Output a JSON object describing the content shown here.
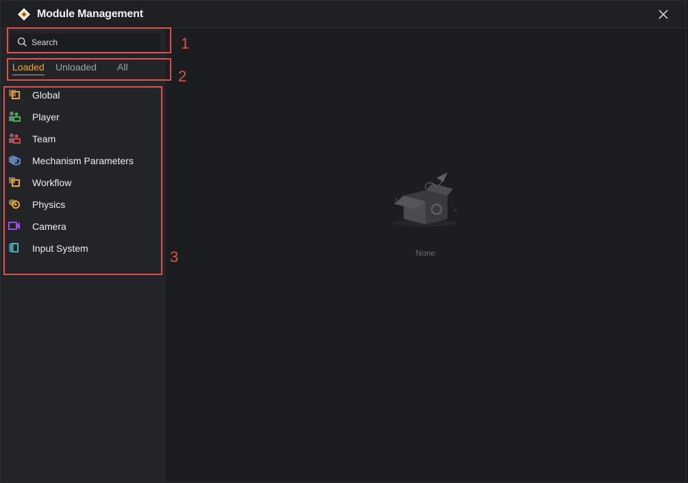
{
  "window": {
    "title": "Module Management"
  },
  "search": {
    "placeholder": "Search"
  },
  "tabs": [
    {
      "label": "Loaded",
      "active": true
    },
    {
      "label": "Unloaded",
      "active": false
    },
    {
      "label": "All",
      "active": false
    }
  ],
  "modules": [
    {
      "label": "Global",
      "icon": "global-icon",
      "color": "#e8a33a"
    },
    {
      "label": "Player",
      "icon": "player-icon",
      "color": "#3fb85c"
    },
    {
      "label": "Team",
      "icon": "team-icon",
      "color": "#d9484f"
    },
    {
      "label": "Mechanism Parameters",
      "icon": "mechanism-icon",
      "color": "#5b8ae8"
    },
    {
      "label": "Workflow",
      "icon": "workflow-icon",
      "color": "#f0a92c"
    },
    {
      "label": "Physics",
      "icon": "physics-icon",
      "color": "#f0a92c"
    },
    {
      "label": "Camera",
      "icon": "camera-icon",
      "color": "#9b4fe0"
    },
    {
      "label": "Input System",
      "icon": "input-system-icon",
      "color": "#2fb6c4"
    }
  ],
  "empty_state": {
    "label": "None",
    "icon": "empty-box-icon"
  },
  "annotations": [
    "1",
    "2",
    "3"
  ],
  "colors": {
    "accent": "#f0a92c",
    "annotation": "#e0524a"
  }
}
